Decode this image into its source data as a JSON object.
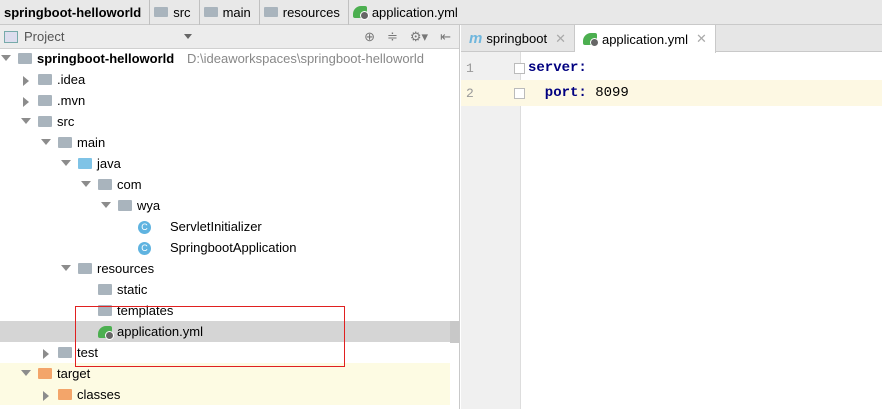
{
  "breadcrumb": [
    "springboot-helloworld",
    "src",
    "main",
    "resources",
    "application.yml"
  ],
  "panel": {
    "title": "Project"
  },
  "tree": [
    {
      "label": "springboot-helloworld",
      "path": "D:\\ideaworkspaces\\springboot-helloworld",
      "level": 0,
      "icon": "module-folder-icon",
      "expanded": true
    },
    {
      "label": ".idea",
      "level": 1,
      "icon": "folder-icon",
      "expanded": false
    },
    {
      "label": ".mvn",
      "level": 1,
      "icon": "folder-icon",
      "expanded": false
    },
    {
      "label": "src",
      "level": 1,
      "icon": "folder-icon",
      "expanded": true
    },
    {
      "label": "main",
      "level": 2,
      "icon": "folder-icon",
      "expanded": true
    },
    {
      "label": "java",
      "level": 3,
      "icon": "source-folder-icon",
      "expanded": true
    },
    {
      "label": "com",
      "level": 4,
      "icon": "package-icon",
      "expanded": true
    },
    {
      "label": "wya",
      "level": 5,
      "icon": "package-icon",
      "expanded": true
    },
    {
      "label": "ServletInitializer",
      "level": 6,
      "icon": "class-icon"
    },
    {
      "label": "SpringbootApplication",
      "level": 6,
      "icon": "spring-class-icon"
    },
    {
      "label": "resources",
      "level": 3,
      "icon": "resources-folder-icon",
      "expanded": true
    },
    {
      "label": "static",
      "level": 4,
      "icon": "folder-icon"
    },
    {
      "label": "templates",
      "level": 4,
      "icon": "folder-icon"
    },
    {
      "label": "application.yml",
      "level": 4,
      "icon": "spring-yml-icon",
      "selected": true
    },
    {
      "label": "test",
      "level": 2,
      "icon": "folder-icon",
      "expanded": false
    },
    {
      "label": "target",
      "level": 1,
      "icon": "excluded-folder-icon",
      "expanded": true
    },
    {
      "label": "classes",
      "level": 2,
      "icon": "excluded-folder-icon",
      "expanded": false
    }
  ],
  "tabs": [
    {
      "label": "springboot",
      "active": false
    },
    {
      "label": "application.yml",
      "active": true
    }
  ],
  "editor": {
    "lines": [
      {
        "n": "1",
        "key": "server:",
        "val": ""
      },
      {
        "n": "2",
        "key": "  port:",
        "val": " 8099"
      }
    ]
  }
}
